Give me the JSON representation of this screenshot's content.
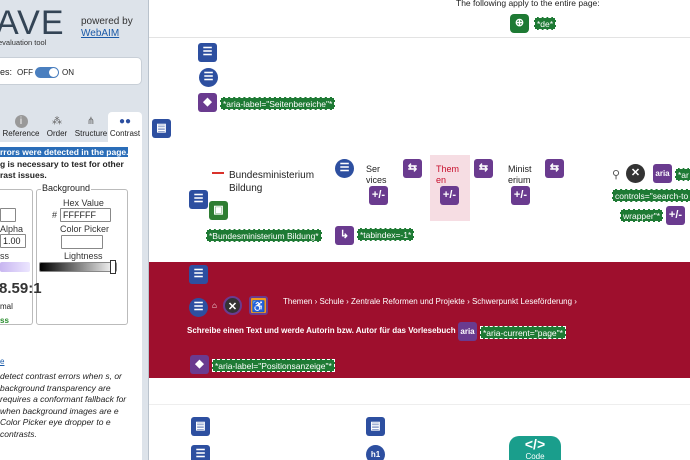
{
  "sidebar": {
    "logo": "AVE",
    "subtitle": "evaluation tool",
    "powered_by": "powered by",
    "webaim": "WebAIM",
    "styles_label": "es:",
    "styles_off": "OFF",
    "styles_on": "ON",
    "tabs": [
      {
        "label": "Reference",
        "icon": "info-icon"
      },
      {
        "label": "Order",
        "icon": "order-icon"
      },
      {
        "label": "Structure",
        "icon": "structure-icon"
      },
      {
        "label": "Contrast",
        "icon": "contrast-icon"
      }
    ],
    "alert_highlight": "rrors were detected in the page.",
    "alert_rest1": "g is necessary to test for other",
    "alert_rest2": "rast issues.",
    "background_legend": "Background",
    "hex_label": "Hex Value",
    "hex_hash": "#",
    "hex_value": "FFFFFF",
    "color_picker_label": "Color Picker",
    "lightness_label": "Lightness",
    "alpha_label": "Alpha",
    "alpha_value": "1.00",
    "fg_lightness_label": "ss",
    "ratio": "8.59:1",
    "normal_label": "mal",
    "pass_label": "ss",
    "link_label": "e",
    "description": "detect contrast errors when s, or background transparency are requires a conformant fallback for when background images are e Color Picker eye dropper to e contrasts."
  },
  "page": {
    "apply_text": "The following apply to the entire page:",
    "lang_tag": "*de*",
    "aria_label_seitenbereiche": "*aria-label=\"Seitenbereiche\"*",
    "logo_line1": "Bundesministerium",
    "logo_line2": "Bildung",
    "logo_alt_tag": "*Bundesministerium Bildung*",
    "tabindex_tag": "*tabindex=-1*",
    "nav_services": [
      "Ser",
      "vices"
    ],
    "nav_themen": [
      "Them",
      "en"
    ],
    "nav_ministerium": [
      "Minist",
      "erium"
    ],
    "aria_controls_tag": "controls=\"search-to",
    "wrapper_tag": "wrapper\"*",
    "aria_partial_tag": "*ar",
    "aria_icon_text": "aria",
    "crumbs": "Themen  ›  Schule  ›  Zentrale Reformen und Projekte  ›  Schwerpunkt Leseförderung  ›",
    "headline": "Schreibe einen Text und werde Autorin bzw. Autor für das Vorlesebuch 2026",
    "aria_current_tag": "*aria-current=\"page\"*",
    "aria_label_position": "*aria-label=\"Positionsanzeige\"*",
    "code_badge_symbol": "</>",
    "code_badge_label": "Code",
    "h1_label": "h1"
  },
  "colors": {
    "band": "#9e0f2d",
    "wave_nav": "#2d4fa0",
    "wave_purple": "#6a3b8f",
    "wave_green": "#1e7a34"
  }
}
